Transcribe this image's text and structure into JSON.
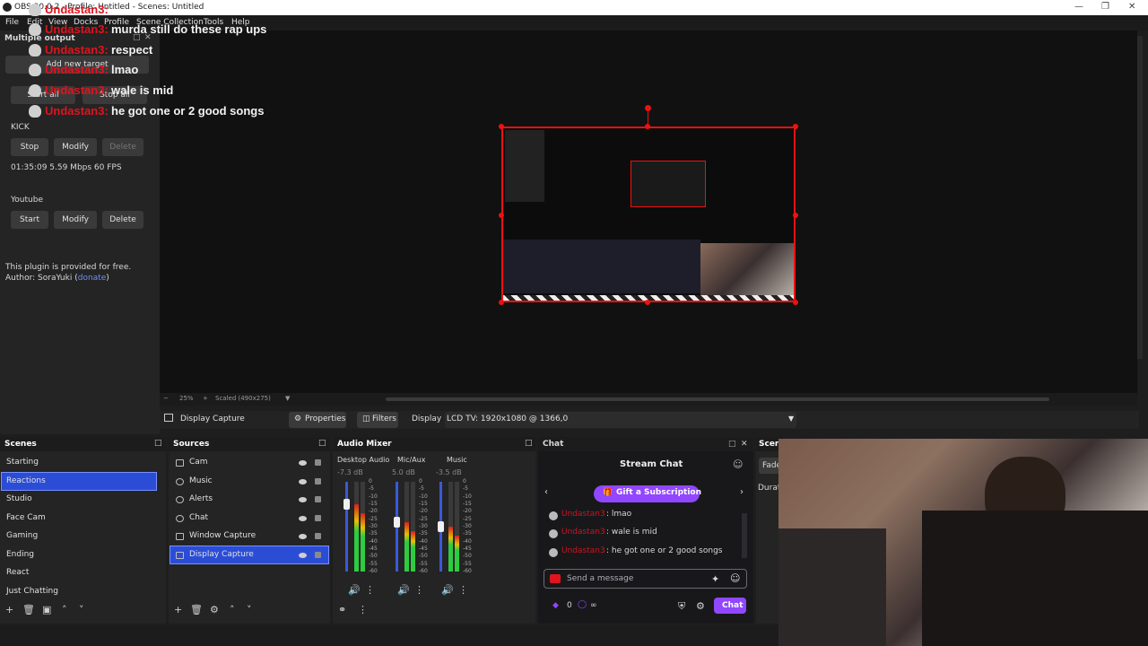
{
  "window": {
    "title": "OBS 30.0.2 - Profile: Untitled - Scenes: Untitled"
  },
  "menu": [
    "File",
    "Edit",
    "View",
    "Docks",
    "Profile",
    "Scene Collection",
    "Tools",
    "Help"
  ],
  "multiple_output": {
    "title": "Multiple output",
    "add_target": "Add new target",
    "start_all": "Start all",
    "stop_all": "Stop all",
    "targets": [
      {
        "name": "KICK",
        "btn1": "Stop",
        "btn2": "Modify",
        "btn3": "Delete",
        "status": "01:35:09  5.59 Mbps  60 FPS"
      },
      {
        "name": "Youtube",
        "btn1": "Start",
        "btn2": "Modify",
        "btn3": "Delete",
        "status": ""
      }
    ],
    "plugin_note": "This plugin is provided for free.",
    "author_prefix": "Author: SoraYuki (",
    "author_link": "donate",
    "author_suffix": ")"
  },
  "chat_overlay": [
    {
      "user": "Undastan3:",
      "msg": ""
    },
    {
      "user": "Undastan3:",
      "msg": "murda still do these rap ups"
    },
    {
      "user": "Undastan3:",
      "msg": "respect"
    },
    {
      "user": "Undastan3:",
      "msg": "lmao"
    },
    {
      "user": "Undastan3:",
      "msg": "wale is mid"
    },
    {
      "user": "Undastan3:",
      "msg": "he got one or 2 good songs"
    }
  ],
  "preview": {
    "zoom": "25%",
    "scaled": "Scaled (490x275)"
  },
  "source_bar": {
    "source_name": "Display Capture",
    "properties": "Properties",
    "filters": "Filters",
    "display_label": "Display",
    "display_value": "LCD TV: 1920x1080 @ 1366,0"
  },
  "scenes": {
    "title": "Scenes",
    "items": [
      "Starting",
      "Reactions",
      "Studio",
      "Face Cam",
      "Gaming",
      "Ending",
      "React",
      "Just Chatting"
    ],
    "selected": 1
  },
  "sources": {
    "title": "Sources",
    "items": [
      "Cam",
      "Music",
      "Alerts",
      "Chat",
      "Window Capture",
      "Display Capture"
    ],
    "selected": 5
  },
  "audio_mixer": {
    "title": "Audio Mixer",
    "channels": [
      {
        "name": "Desktop Audio",
        "db": "-7.3 dB",
        "level": 0.75
      },
      {
        "name": "Mic/Aux",
        "db": "5.0 dB",
        "level": 0.55
      },
      {
        "name": "Music",
        "db": "-3.5 dB",
        "level": 0.5
      }
    ],
    "scale": [
      "0",
      "-5",
      "-10",
      "-15",
      "-20",
      "-25",
      "-30",
      "-35",
      "-40",
      "-45",
      "-50",
      "-55",
      "-60"
    ]
  },
  "chat_dock": {
    "title": "Chat",
    "header": "Stream Chat",
    "gift_button": "Gift a Subscription",
    "messages": [
      {
        "user": "Undastan3",
        "msg": ": lmao"
      },
      {
        "user": "Undastan3",
        "msg": ": wale is mid"
      },
      {
        "user": "Undastan3",
        "msg": ": he got one or 2 good songs"
      }
    ],
    "input_placeholder": "Send a message",
    "points": "0",
    "infinity": "∞",
    "send_button": "Chat"
  },
  "scene_transitions": {
    "title": "Scen",
    "fade": "Fade",
    "duration": "Durat"
  },
  "colors": {
    "selected": "#2b4dd6",
    "kick_red": "#e0141e",
    "twitch_purple": "#9147ff"
  }
}
